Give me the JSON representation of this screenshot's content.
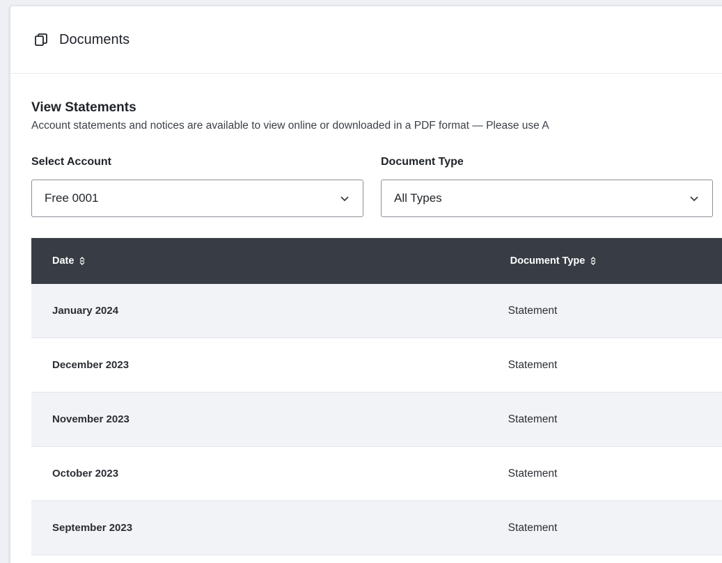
{
  "header": {
    "title": "Documents",
    "icon": "copy-icon"
  },
  "statements": {
    "title": "View Statements",
    "description": "Account statements and notices are available to view online or downloaded in a PDF format — Please use A"
  },
  "filters": {
    "account": {
      "label": "Select Account",
      "value": "Free 0001"
    },
    "doc_type": {
      "label": "Document Type",
      "value": "All Types"
    }
  },
  "table": {
    "columns": [
      "Date",
      "Document Type"
    ],
    "rows": [
      {
        "date": "January 2024",
        "type": "Statement"
      },
      {
        "date": "December 2023",
        "type": "Statement"
      },
      {
        "date": "November 2023",
        "type": "Statement"
      },
      {
        "date": "October 2023",
        "type": "Statement"
      },
      {
        "date": "September 2023",
        "type": "Statement"
      }
    ]
  },
  "colors": {
    "header_bg": "#383c44",
    "alt_row_bg": "#f2f3f6"
  }
}
